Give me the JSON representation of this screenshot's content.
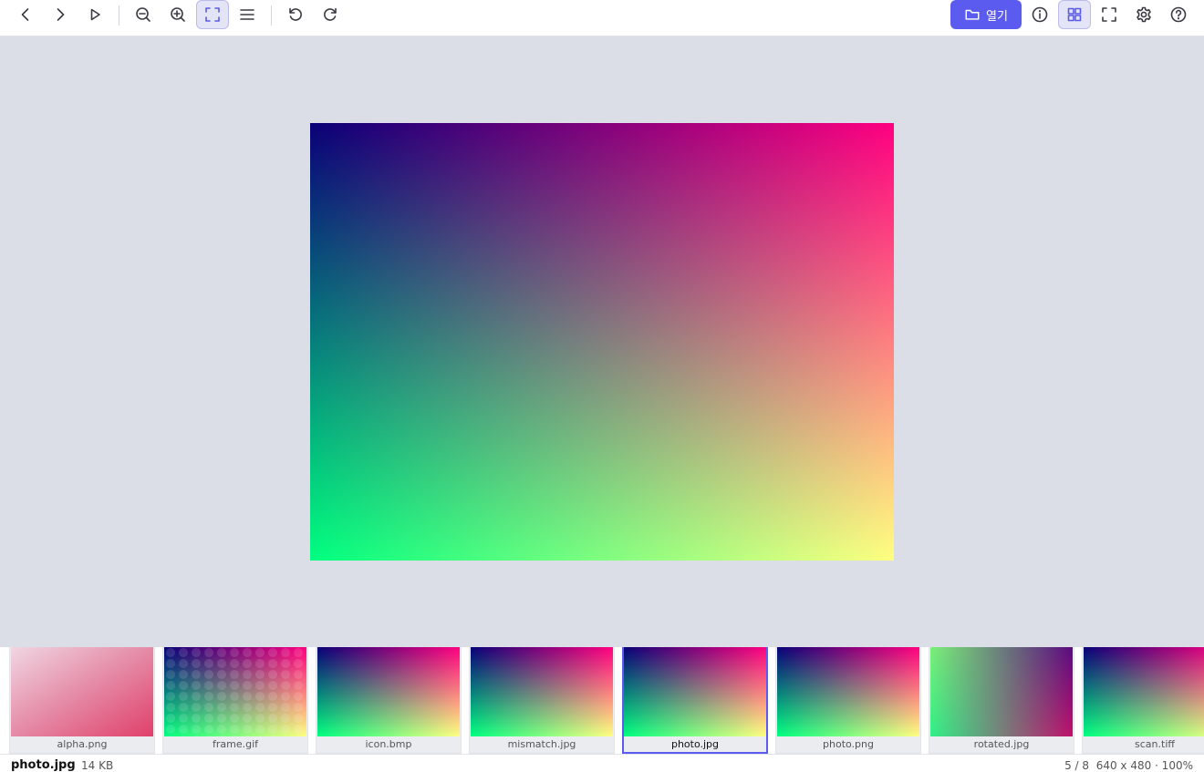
{
  "toolbar": {
    "left_buttons": [
      {
        "id": "prev",
        "icon": "chevron-left-icon",
        "active": false
      },
      {
        "id": "next",
        "icon": "chevron-right-icon",
        "active": false
      },
      {
        "id": "slideshow",
        "icon": "play-icon",
        "active": false
      },
      {
        "id": "zoom-out",
        "icon": "zoom-out-icon",
        "active": false
      },
      {
        "id": "zoom-in",
        "icon": "zoom-in-icon",
        "active": false
      },
      {
        "id": "fit",
        "icon": "fit-to-window-icon",
        "active": true
      },
      {
        "id": "menu",
        "icon": "menu-icon",
        "active": false
      },
      {
        "id": "rotate-left",
        "icon": "rotate-left-icon",
        "active": false
      },
      {
        "id": "rotate-right",
        "icon": "rotate-right-icon",
        "active": false
      }
    ],
    "open_label": "열기",
    "right_buttons": [
      {
        "id": "info",
        "icon": "info-icon",
        "active": false
      },
      {
        "id": "gallery",
        "icon": "grid-icon",
        "active": true
      },
      {
        "id": "fullscreen",
        "icon": "fullscreen-icon",
        "active": false
      },
      {
        "id": "settings",
        "icon": "gear-icon",
        "active": false
      },
      {
        "id": "help",
        "icon": "help-icon",
        "active": false
      }
    ],
    "accent_color": "#5b5bef"
  },
  "viewer": {
    "background": "#dcdee7",
    "image": {
      "name": "photo.jpg",
      "colors": {
        "top_left": "#0a0078",
        "top_right": "#ff0080",
        "bottom_left": "#00ff80",
        "bottom_right": "#ffff80"
      }
    }
  },
  "thumbnails": [
    {
      "label": "alpha.png",
      "selected": false
    },
    {
      "label": "frame.gif",
      "selected": false
    },
    {
      "label": "icon.bmp",
      "selected": false
    },
    {
      "label": "mismatch.jpg",
      "selected": false
    },
    {
      "label": "photo.jpg",
      "selected": true
    },
    {
      "label": "photo.png",
      "selected": false
    },
    {
      "label": "rotated.jpg",
      "selected": false
    },
    {
      "label": "scan.tiff",
      "selected": false
    }
  ],
  "status": {
    "filename": "photo.jpg",
    "filesize": "14 KB",
    "position": "5 / 8",
    "dimensions": "640 x 480 · 100%"
  }
}
